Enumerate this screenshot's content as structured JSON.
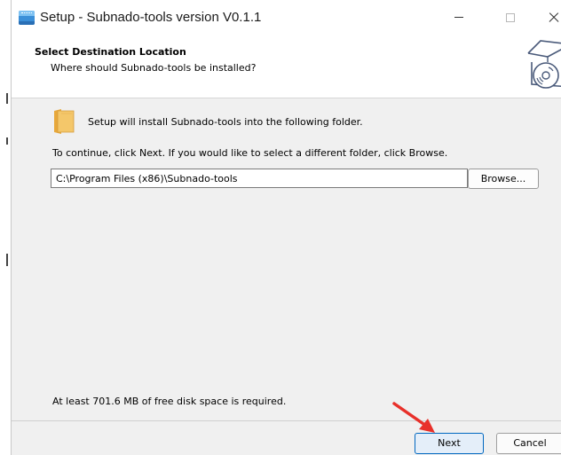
{
  "window": {
    "title": "Setup - Subnado-tools version V0.1.1"
  },
  "header": {
    "title": "Select Destination Location",
    "subtitle": "Where should Subnado-tools be installed?"
  },
  "body": {
    "install_message": "Setup will install Subnado-tools into the following folder.",
    "continue_message": "To continue, click Next. If you would like to select a different folder, click Browse.",
    "install_path": "C:\\Program Files (x86)\\Subnado-tools",
    "browse_label": "Browse...",
    "disk_space_message": "At least 701.6 MB of free disk space is required."
  },
  "footer": {
    "next_label": "Next",
    "cancel_label": "Cancel"
  },
  "icons": {
    "app": "installer-app-icon",
    "wizard": "box-with-disc-icon",
    "folder": "folder-icon",
    "annotation": "red-arrow-icon"
  },
  "colors": {
    "accent": "#0067c0",
    "arrow": "#e8302a",
    "folder": "#f4c76a"
  }
}
